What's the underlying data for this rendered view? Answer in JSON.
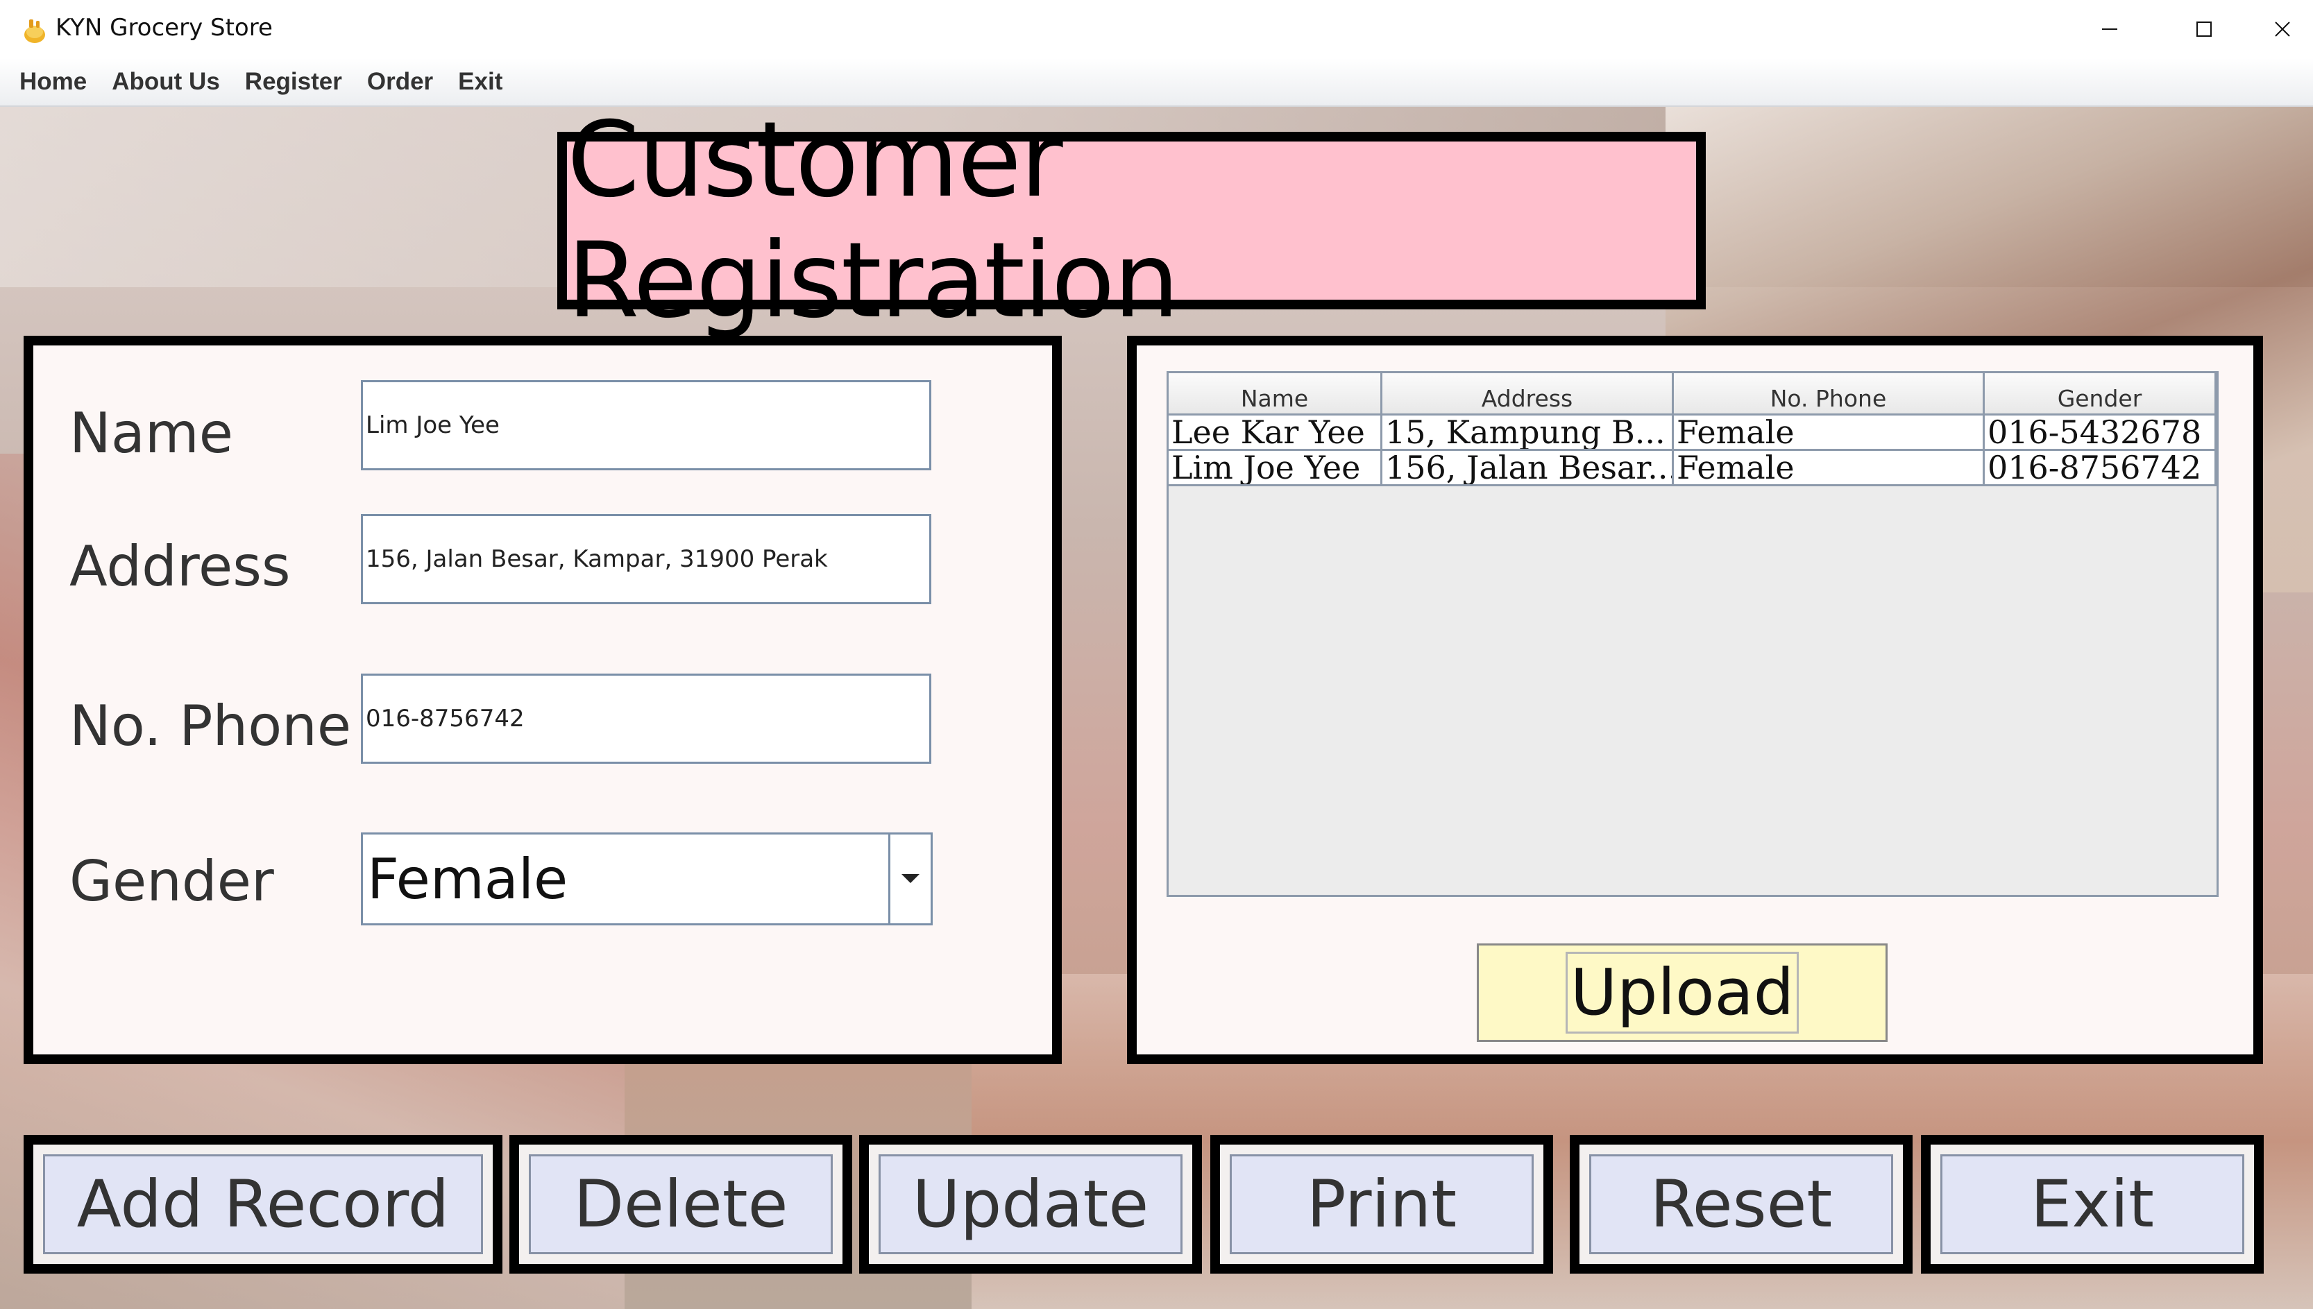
{
  "window": {
    "title": "KYN Grocery Store",
    "icons": {
      "app": "grocery-app-icon",
      "minimize": "minimize-icon",
      "maximize": "maximize-icon",
      "close": "close-icon"
    }
  },
  "menu": [
    "Home",
    "About Us",
    "Register",
    "Order",
    "Exit"
  ],
  "header": {
    "title": "Customer Registration"
  },
  "form": {
    "name_label": "Name",
    "name_value": "Lim Joe Yee",
    "address_label": "Address",
    "address_value": "156, Jalan Besar, Kampar, 31900 Perak",
    "phone_label": "No. Phone",
    "phone_value": "016-8756742",
    "gender_label": "Gender",
    "gender_value": "Female"
  },
  "table": {
    "columns": [
      "Name",
      "Address",
      "No. Phone",
      "Gender"
    ],
    "rows": [
      [
        "Lee Kar Yee",
        "15, Kampung B...",
        "Female",
        "016-5432678"
      ],
      [
        "Lim Joe Yee",
        "156, Jalan Besar...",
        "Female",
        "016-8756742"
      ]
    ]
  },
  "upload_label": "Upload",
  "actions": {
    "add": "Add Record",
    "delete": "Delete",
    "update": "Update",
    "print": "Print",
    "reset": "Reset",
    "exit": "Exit"
  },
  "colors": {
    "header_bg": "#ffc1ce",
    "panel_border": "#000000",
    "button_bg": "#e1e4f5",
    "upload_bg": "#fef9c6"
  }
}
